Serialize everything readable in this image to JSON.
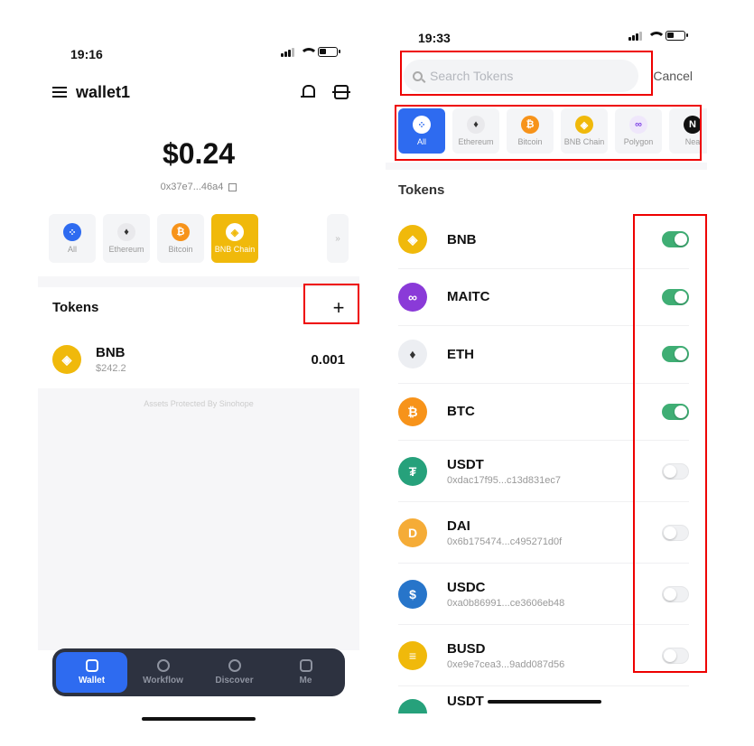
{
  "left": {
    "time": "19:16",
    "wallet_name": "wallet1",
    "balance": "$0.24",
    "address": "0x37e7...46a4",
    "chains": [
      {
        "label": "All",
        "glyph": "⁘"
      },
      {
        "label": "Ethereum",
        "glyph": "♦"
      },
      {
        "label": "Bitcoin",
        "glyph": "₿"
      },
      {
        "label": "BNB Chain",
        "glyph": "◈"
      }
    ],
    "more_glyph": "»",
    "tokens_title": "Tokens",
    "add_glyph": "+",
    "token": {
      "name": "BNB",
      "value": "$242.2",
      "amount": "0.001",
      "glyph": "◈"
    },
    "protected_text": "Assets Protected By Sinohope",
    "tabs": [
      {
        "label": "Wallet",
        "icon": "wallet-icon"
      },
      {
        "label": "Workflow",
        "icon": "workflow-icon"
      },
      {
        "label": "Discover",
        "icon": "compass-icon"
      },
      {
        "label": "Me",
        "icon": "user-icon"
      }
    ]
  },
  "right": {
    "time": "19:33",
    "search_placeholder": "Search Tokens",
    "cancel_label": "Cancel",
    "chains": [
      {
        "label": "All",
        "glyph": "⁘"
      },
      {
        "label": "Ethereum",
        "glyph": "♦"
      },
      {
        "label": "Bitcoin",
        "glyph": "₿"
      },
      {
        "label": "BNB Chain",
        "glyph": "◈"
      },
      {
        "label": "Polygon",
        "glyph": "∞"
      },
      {
        "label": "Nea",
        "glyph": "N"
      }
    ],
    "tokens_title": "Tokens",
    "tokens": [
      {
        "name": "BNB",
        "address": "",
        "enabled": true,
        "glyph": "◈"
      },
      {
        "name": "MAITC",
        "address": "",
        "enabled": true,
        "glyph": "∞"
      },
      {
        "name": "ETH",
        "address": "",
        "enabled": true,
        "glyph": "♦"
      },
      {
        "name": "BTC",
        "address": "",
        "enabled": true,
        "glyph": "₿"
      },
      {
        "name": "USDT",
        "address": "0xdac17f95...c13d831ec7",
        "enabled": false,
        "glyph": "₮"
      },
      {
        "name": "DAI",
        "address": "0x6b175474...c495271d0f",
        "enabled": false,
        "glyph": "D"
      },
      {
        "name": "USDC",
        "address": "0xa0b86991...ce3606eb48",
        "enabled": false,
        "glyph": "$"
      },
      {
        "name": "BUSD",
        "address": "0xe9e7cea3...9add087d56",
        "enabled": false,
        "glyph": "≡"
      }
    ],
    "partial_token": "USDT"
  },
  "colors": {
    "accent_blue": "#2e6bf0",
    "bnb_yellow": "#f0b90b",
    "toggle_on": "#3fae74",
    "highlight_red": "#e00000"
  }
}
